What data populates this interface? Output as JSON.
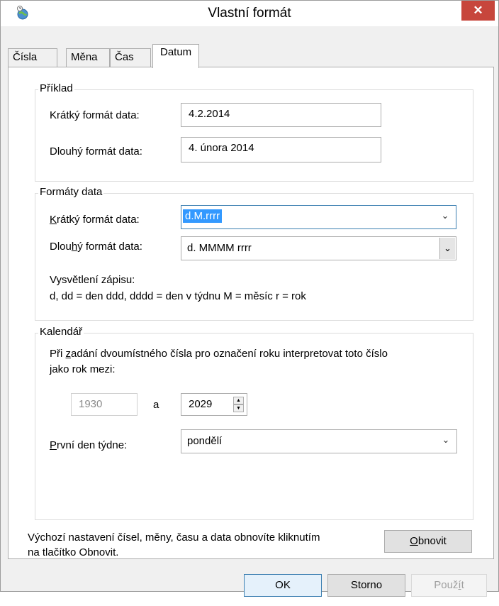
{
  "window": {
    "title": "Vlastní formát",
    "close_glyph": "✕"
  },
  "tabs": [
    {
      "label": "Čísla"
    },
    {
      "label": "Měna"
    },
    {
      "label": "Čas"
    },
    {
      "label": "Datum"
    }
  ],
  "example": {
    "legend": "Příklad",
    "short_label": "Krátký formát data:",
    "short_value": "4.2.2014",
    "long_label": "Dlouhý formát data:",
    "long_value": "4. února 2014"
  },
  "formats": {
    "legend": "Formáty data",
    "short_label_pre": "",
    "short_label_ul": "K",
    "short_label_post": "rátký formát data:",
    "short_value": "d.M.rrrr",
    "long_label_pre": "Dlou",
    "long_label_ul": "h",
    "long_label_post": "ý formát data:",
    "long_value": "d. MMMM rrrr",
    "explain_title": "Vysvětlení zápisu:",
    "explain_text": "d, dd = den  ddd, dddd = den v týdnu  M = měsíc  r = rok"
  },
  "calendar": {
    "legend": "Kalendář",
    "desc_pre": "Při ",
    "desc_ul": "z",
    "desc_post": "adání dvoumístného čísla pro označení roku interpretovat toto číslo",
    "desc_line2": "jako rok mezi:",
    "year_from": "1930",
    "and_label": "a",
    "year_to": "2029",
    "first_day_ul": "P",
    "first_day_post": "rvní den týdne:",
    "first_day_value": "pondělí"
  },
  "reset": {
    "text_line1": "Výchozí nastavení čísel, měny, času a data obnovíte kliknutím",
    "text_line2": "na tlačítko Obnovit.",
    "button_ul": "O",
    "button_post": "bnovit"
  },
  "footer": {
    "ok": "OK",
    "cancel": "Storno",
    "apply_pre": "Použ",
    "apply_ul": "í",
    "apply_post": "t"
  },
  "icons": {
    "dropdown": "⌄",
    "spin_up": "▲",
    "spin_down": "▼"
  },
  "colors": {
    "selection": "#3399ff",
    "close_button": "#c7463c"
  }
}
